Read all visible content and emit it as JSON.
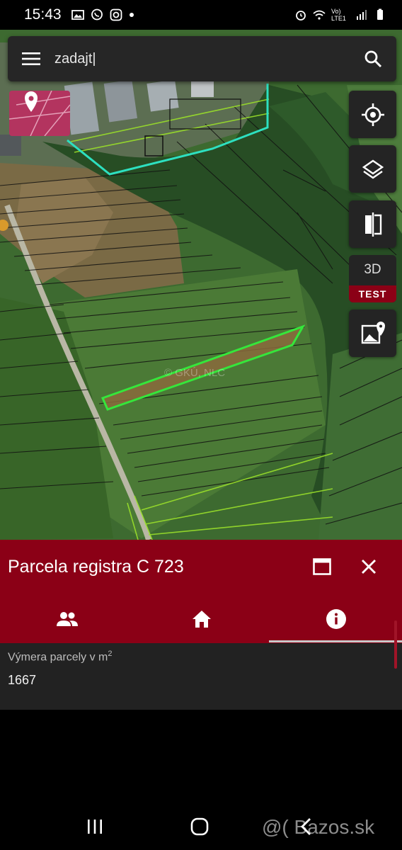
{
  "status": {
    "time": "15:43",
    "network_label": "Vo) LTE1"
  },
  "search": {
    "query": "zadajt|"
  },
  "map": {
    "watermark": "© GKÚ, NLC"
  },
  "buttons_3d": {
    "label": "3D",
    "badge": "TEST"
  },
  "parcel": {
    "title": "Parcela registra C 723",
    "area_label": "Výmera parcely v m",
    "area_label_sup": "2",
    "area_value": "1667"
  },
  "tabs": [
    {
      "name": "owners",
      "icon": "people-icon"
    },
    {
      "name": "home",
      "icon": "home-icon"
    },
    {
      "name": "info",
      "icon": "info-icon"
    }
  ],
  "colors": {
    "accent": "#8b0016",
    "panel": "#242424",
    "selected_parcel": "#35e63b",
    "boundary_cyan": "#2de0c0"
  },
  "footer_watermark": "@( Bazos.sk"
}
